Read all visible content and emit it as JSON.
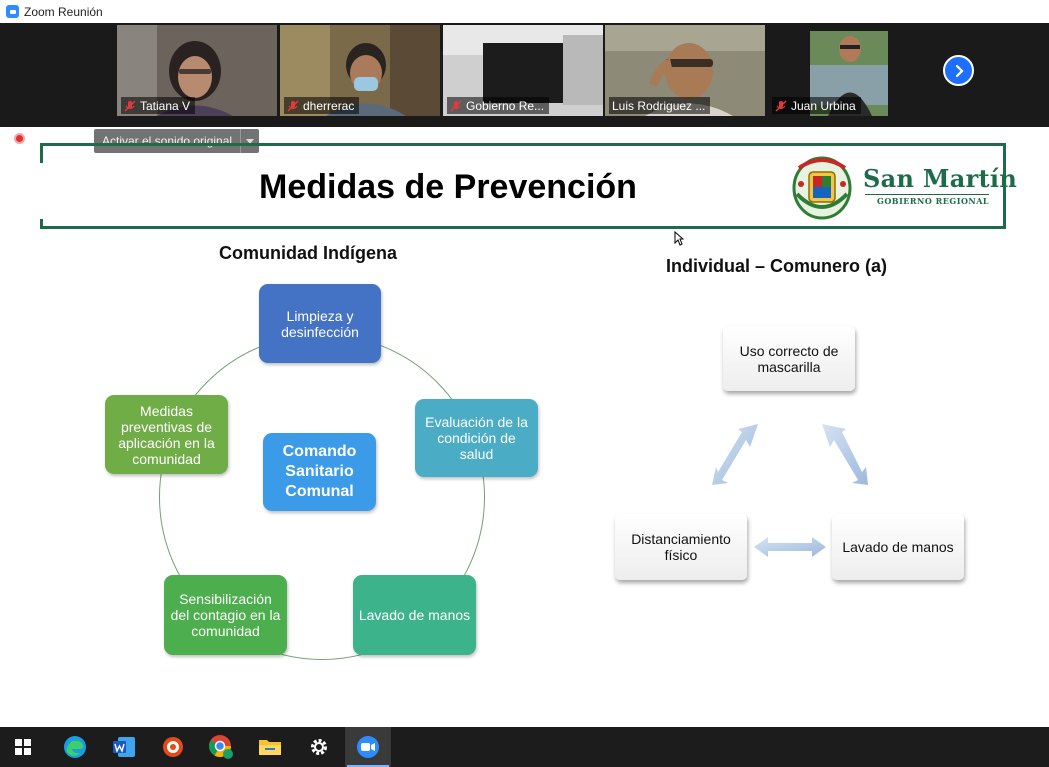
{
  "window": {
    "title": "Zoom Reunión"
  },
  "participants": [
    {
      "name": "Tatiana V",
      "muted": true,
      "active": false
    },
    {
      "name": "dherrerac",
      "muted": true,
      "active": false
    },
    {
      "name": "Gobierno Re...",
      "muted": true,
      "active": false
    },
    {
      "name": "Luis Rodriguez ...",
      "muted": false,
      "active": true
    },
    {
      "name": "Juan Urbina",
      "muted": true,
      "active": false
    }
  ],
  "controls": {
    "original_sound": "Activar el sonido original",
    "next_icon": "chevron-right-icon"
  },
  "slide": {
    "title": "Medidas de Prevención",
    "logo": {
      "brand": "San Martín",
      "subtitle": "GOBIERNO REGIONAL"
    },
    "left": {
      "heading": "Comunidad Indígena",
      "center": "Comando Sanitario Comunal",
      "nodes": [
        {
          "label": "Limpieza y desinfección",
          "color": "#4472c4"
        },
        {
          "label": "Evaluación de la condición de salud",
          "color": "#4bacc6"
        },
        {
          "label": "Lavado de manos",
          "color": "#3cb38a"
        },
        {
          "label": "Sensibilización del contagio en la comunidad",
          "color": "#4cae4c"
        },
        {
          "label": "Medidas preventivas de aplicación en la comunidad",
          "color": "#70ad47"
        }
      ],
      "center_color": "#3c9be8"
    },
    "right": {
      "heading": "Individual – Comunero (a)",
      "nodes": [
        {
          "label": "Uso correcto de mascarilla"
        },
        {
          "label": "Lavado de manos"
        },
        {
          "label": "Distanciamiento físico"
        }
      ]
    }
  },
  "taskbar": {
    "items": [
      "windows-start-icon",
      "edge-icon",
      "word-icon",
      "app-icon",
      "chrome-icon",
      "file-explorer-icon",
      "settings-icon",
      "zoom-icon"
    ]
  }
}
